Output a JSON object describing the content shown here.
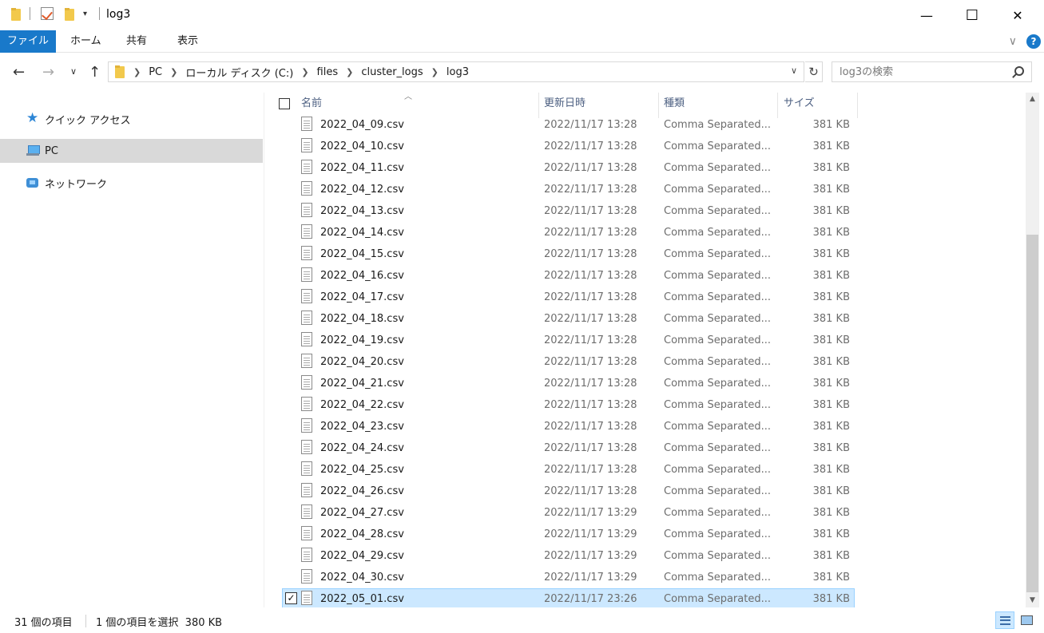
{
  "window": {
    "title": "log3",
    "minimize_glyph": "—",
    "maximize_glyph": "☐",
    "close_glyph": "✕"
  },
  "ribbon": {
    "tabs": [
      "ファイル",
      "ホーム",
      "共有",
      "表示"
    ],
    "accent_color": "#1979ca",
    "help_glyph": "?",
    "collapse_glyph": "∨"
  },
  "address": {
    "crumbs": [
      "PC",
      "ローカル ディスク (C:)",
      "files",
      "cluster_logs",
      "log3"
    ],
    "dropdown_glyph": "∨",
    "refresh_glyph": "↻"
  },
  "search": {
    "placeholder": "log3の検索"
  },
  "nav": {
    "back_glyph": "←",
    "forward_glyph": "→",
    "recent_glyph": "∨",
    "up_glyph": "↑",
    "items": [
      {
        "label": "クイック アクセス",
        "icon": "star-icon"
      },
      {
        "label": "PC",
        "icon": "pc-icon",
        "selected": true
      },
      {
        "label": "ネットワーク",
        "icon": "network-icon"
      }
    ]
  },
  "columns": {
    "name": "名前",
    "date": "更新日時",
    "type": "種類",
    "size": "サイズ"
  },
  "files": [
    {
      "name": "2022_04_09.csv",
      "date": "2022/11/17 13:28",
      "type": "Comma Separated...",
      "size": "381 KB"
    },
    {
      "name": "2022_04_10.csv",
      "date": "2022/11/17 13:28",
      "type": "Comma Separated...",
      "size": "381 KB"
    },
    {
      "name": "2022_04_11.csv",
      "date": "2022/11/17 13:28",
      "type": "Comma Separated...",
      "size": "381 KB"
    },
    {
      "name": "2022_04_12.csv",
      "date": "2022/11/17 13:28",
      "type": "Comma Separated...",
      "size": "381 KB"
    },
    {
      "name": "2022_04_13.csv",
      "date": "2022/11/17 13:28",
      "type": "Comma Separated...",
      "size": "381 KB"
    },
    {
      "name": "2022_04_14.csv",
      "date": "2022/11/17 13:28",
      "type": "Comma Separated...",
      "size": "381 KB"
    },
    {
      "name": "2022_04_15.csv",
      "date": "2022/11/17 13:28",
      "type": "Comma Separated...",
      "size": "381 KB"
    },
    {
      "name": "2022_04_16.csv",
      "date": "2022/11/17 13:28",
      "type": "Comma Separated...",
      "size": "381 KB"
    },
    {
      "name": "2022_04_17.csv",
      "date": "2022/11/17 13:28",
      "type": "Comma Separated...",
      "size": "381 KB"
    },
    {
      "name": "2022_04_18.csv",
      "date": "2022/11/17 13:28",
      "type": "Comma Separated...",
      "size": "381 KB"
    },
    {
      "name": "2022_04_19.csv",
      "date": "2022/11/17 13:28",
      "type": "Comma Separated...",
      "size": "381 KB"
    },
    {
      "name": "2022_04_20.csv",
      "date": "2022/11/17 13:28",
      "type": "Comma Separated...",
      "size": "381 KB"
    },
    {
      "name": "2022_04_21.csv",
      "date": "2022/11/17 13:28",
      "type": "Comma Separated...",
      "size": "381 KB"
    },
    {
      "name": "2022_04_22.csv",
      "date": "2022/11/17 13:28",
      "type": "Comma Separated...",
      "size": "381 KB"
    },
    {
      "name": "2022_04_23.csv",
      "date": "2022/11/17 13:28",
      "type": "Comma Separated...",
      "size": "381 KB"
    },
    {
      "name": "2022_04_24.csv",
      "date": "2022/11/17 13:28",
      "type": "Comma Separated...",
      "size": "381 KB"
    },
    {
      "name": "2022_04_25.csv",
      "date": "2022/11/17 13:28",
      "type": "Comma Separated...",
      "size": "381 KB"
    },
    {
      "name": "2022_04_26.csv",
      "date": "2022/11/17 13:28",
      "type": "Comma Separated...",
      "size": "381 KB"
    },
    {
      "name": "2022_04_27.csv",
      "date": "2022/11/17 13:29",
      "type": "Comma Separated...",
      "size": "381 KB"
    },
    {
      "name": "2022_04_28.csv",
      "date": "2022/11/17 13:29",
      "type": "Comma Separated...",
      "size": "381 KB"
    },
    {
      "name": "2022_04_29.csv",
      "date": "2022/11/17 13:29",
      "type": "Comma Separated...",
      "size": "381 KB"
    },
    {
      "name": "2022_04_30.csv",
      "date": "2022/11/17 13:29",
      "type": "Comma Separated...",
      "size": "381 KB"
    },
    {
      "name": "2022_05_01.csv",
      "date": "2022/11/17 23:26",
      "type": "Comma Separated...",
      "size": "381 KB",
      "selected": true
    }
  ],
  "status": {
    "item_count": "31 個の項目",
    "selection": "1 個の項目を選択  380 KB"
  },
  "colors": {
    "selection_fill": "#cce8ff",
    "selection_border": "#99d1ff",
    "nav_selected": "#d9d9d9"
  }
}
